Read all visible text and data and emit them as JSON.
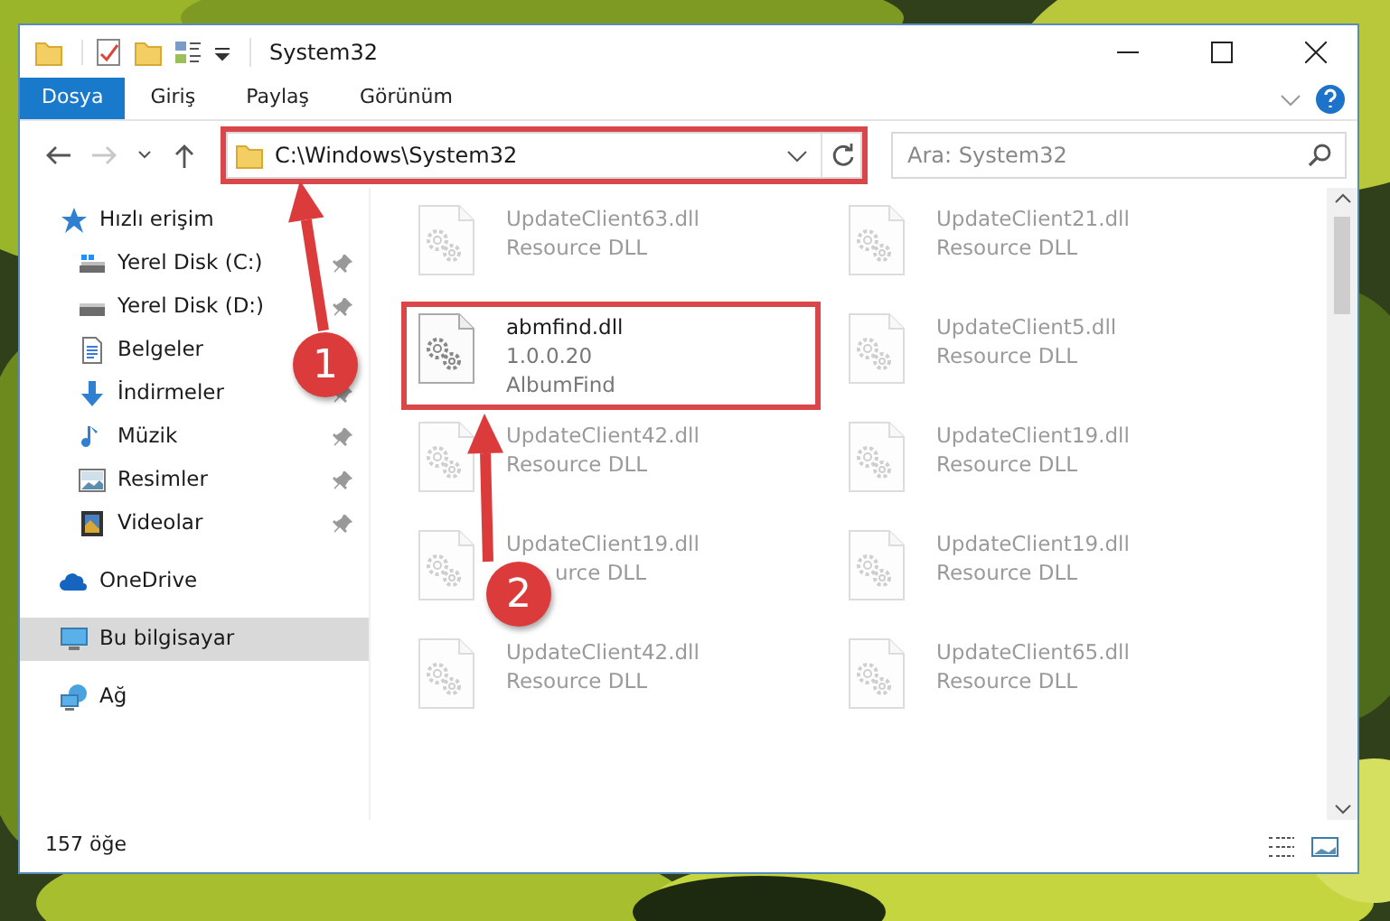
{
  "window": {
    "title": "System32"
  },
  "ribbon_tabs": [
    {
      "label": "Dosya",
      "selected": true
    },
    {
      "label": "Giriş",
      "selected": false
    },
    {
      "label": "Paylaş",
      "selected": false
    },
    {
      "label": "Görünüm",
      "selected": false
    }
  ],
  "navigation": {
    "forward_disabled": true
  },
  "address": {
    "path": "C:\\Windows\\System32",
    "highlighted": true
  },
  "search": {
    "placeholder": "Ara: System32"
  },
  "nav_pane": [
    {
      "label": "Hızlı erişim",
      "kind": "star",
      "selected": false,
      "children": [
        {
          "label": "Yerel Disk (C:)",
          "kind": "drive-c",
          "pinned": true
        },
        {
          "label": "Yerel Disk (D:)",
          "kind": "drive",
          "pinned": true
        },
        {
          "label": "Belgeler",
          "kind": "documents"
        },
        {
          "label": "İndirmeler",
          "kind": "downloads",
          "pinned": true
        },
        {
          "label": "Müzik",
          "kind": "music",
          "pinned": true
        },
        {
          "label": "Resimler",
          "kind": "pictures",
          "pinned": true
        },
        {
          "label": "Videolar",
          "kind": "videos",
          "pinned": true
        }
      ]
    },
    {
      "label": "OneDrive",
      "kind": "cloud",
      "selected": false
    },
    {
      "label": "Bu bilgisayar",
      "kind": "computer",
      "selected": true
    },
    {
      "label": "Ağ",
      "kind": "network",
      "selected": false
    }
  ],
  "files": [
    {
      "name": "UpdateClient63.dll",
      "line_2": "Resource DLL",
      "blurred": true,
      "highlighted": false
    },
    {
      "name": "UpdateClient21.dll",
      "line_2": "Resource DLL",
      "blurred": true,
      "highlighted": false
    },
    {
      "name": "abmfind.dll",
      "line_2": "1.0.0.20",
      "line_3": "AlbumFind",
      "blurred": false,
      "highlighted": true
    },
    {
      "name": "UpdateClient5.dll",
      "line_2": "Resource DLL",
      "blurred": true,
      "highlighted": false
    },
    {
      "name": "UpdateClient42.dll",
      "line_2": "Resource DLL",
      "blurred": true,
      "highlighted": false
    },
    {
      "name": "UpdateClient19.dll",
      "line_2": "Resource DLL",
      "blurred": true,
      "highlighted": false
    },
    {
      "name": "UpdateClient19.dll",
      "line_2": "urce DLL",
      "line_2_covered": true,
      "blurred": true,
      "highlighted": false
    },
    {
      "name": "UpdateClient19.dll",
      "line_2": "Resource DLL",
      "blurred": true,
      "highlighted": false
    },
    {
      "name": "UpdateClient42.dll",
      "line_2": "Resource DLL",
      "blurred": true,
      "highlighted": false
    },
    {
      "name": "UpdateClient65.dll",
      "line_2": "Resource DLL",
      "blurred": true,
      "highlighted": false
    }
  ],
  "status_bar": {
    "count": "157 öğe"
  },
  "callouts": [
    {
      "number": "1"
    },
    {
      "number": "2"
    }
  ]
}
